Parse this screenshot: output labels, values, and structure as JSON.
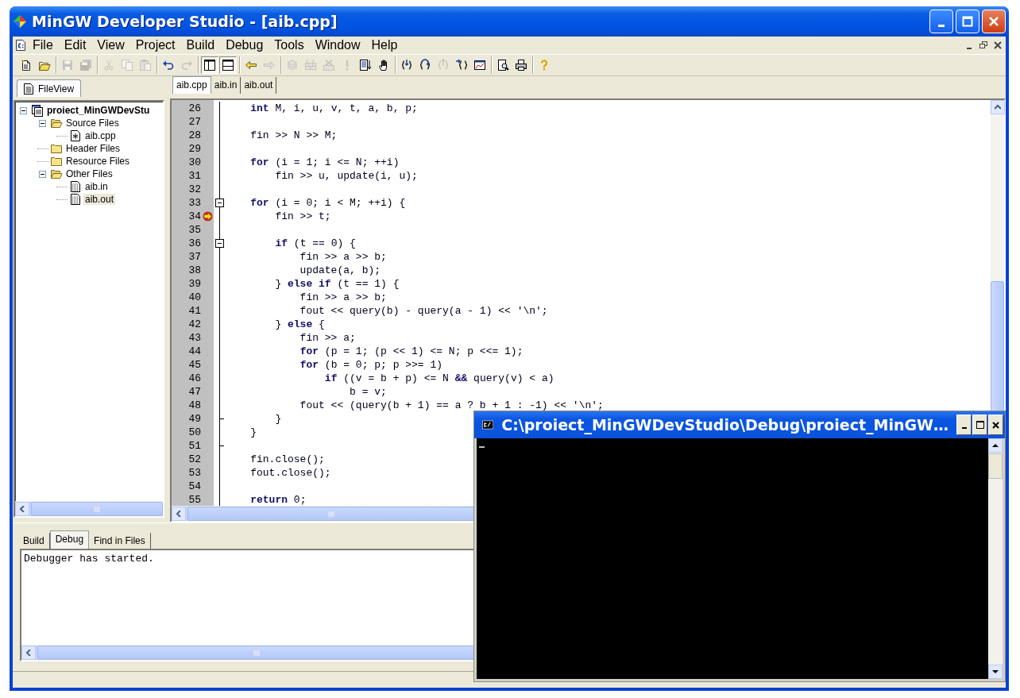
{
  "window": {
    "title": "MinGW Developer Studio - [aib.cpp]"
  },
  "menu": [
    {
      "label": "File"
    },
    {
      "label": "Edit"
    },
    {
      "label": "View"
    },
    {
      "label": "Project"
    },
    {
      "label": "Build"
    },
    {
      "label": "Debug"
    },
    {
      "label": "Tools"
    },
    {
      "label": "Window"
    },
    {
      "label": "Help"
    }
  ],
  "toolbar": [
    [
      {
        "kind": "new",
        "disabled": false,
        "pressed": false
      },
      {
        "kind": "open",
        "disabled": false,
        "pressed": false
      }
    ],
    [
      {
        "kind": "save",
        "disabled": true,
        "pressed": false
      },
      {
        "kind": "save_all",
        "disabled": true,
        "pressed": false
      }
    ],
    [
      {
        "kind": "cut",
        "disabled": true,
        "pressed": false
      },
      {
        "kind": "copy",
        "disabled": true,
        "pressed": false
      },
      {
        "kind": "paste",
        "disabled": true,
        "pressed": false
      }
    ],
    [
      {
        "kind": "undo",
        "disabled": false,
        "pressed": false
      },
      {
        "kind": "redo",
        "disabled": true,
        "pressed": false
      }
    ],
    [
      {
        "kind": "pane_left",
        "disabled": false,
        "pressed": true
      },
      {
        "kind": "pane_bottom",
        "disabled": false,
        "pressed": true
      }
    ],
    [
      {
        "kind": "back",
        "disabled": false,
        "pressed": false
      },
      {
        "kind": "forward",
        "disabled": true,
        "pressed": false
      }
    ],
    [
      {
        "kind": "compile",
        "disabled": true,
        "pressed": false
      },
      {
        "kind": "build",
        "disabled": true,
        "pressed": false
      },
      {
        "kind": "stop",
        "disabled": true,
        "pressed": false
      },
      {
        "kind": "execute",
        "disabled": true,
        "pressed": false
      },
      {
        "kind": "go",
        "disabled": false,
        "pressed": false
      },
      {
        "kind": "hand",
        "disabled": false,
        "pressed": false
      }
    ],
    [
      {
        "kind": "step_into",
        "disabled": false,
        "pressed": false
      },
      {
        "kind": "step_over",
        "disabled": false,
        "pressed": false
      },
      {
        "kind": "step_out",
        "disabled": true,
        "pressed": false
      },
      {
        "kind": "run_cursor",
        "disabled": false,
        "pressed": false
      },
      {
        "kind": "watch",
        "disabled": false,
        "pressed": false
      }
    ],
    [
      {
        "kind": "preview",
        "disabled": false,
        "pressed": false
      },
      {
        "kind": "print",
        "disabled": false,
        "pressed": false
      }
    ],
    [
      {
        "kind": "help",
        "disabled": false,
        "pressed": false
      }
    ]
  ],
  "sidebar": {
    "tabs": [
      {
        "label": "FileView",
        "selected": true
      }
    ],
    "tree": [
      {
        "label": "proiect_MinGWDevStu",
        "kind": "project",
        "expanded": true,
        "selected": false,
        "children": [
          {
            "label": "Source Files",
            "kind": "folder",
            "expanded": true,
            "selected": false,
            "children": [
              {
                "label": "aib.cpp",
                "kind": "source",
                "selected": false
              }
            ]
          },
          {
            "label": "Header Files",
            "kind": "folder",
            "expanded": false,
            "selected": false
          },
          {
            "label": "Resource Files",
            "kind": "folder",
            "expanded": false,
            "selected": false
          },
          {
            "label": "Other Files",
            "kind": "folder",
            "expanded": true,
            "selected": false,
            "children": [
              {
                "label": "aib.in",
                "kind": "file",
                "selected": false
              },
              {
                "label": "aib.out",
                "kind": "file",
                "selected": true
              }
            ]
          }
        ]
      }
    ]
  },
  "editor": {
    "tabs": [
      {
        "label": "aib.cpp",
        "selected": true
      },
      {
        "label": "aib.in",
        "selected": false
      },
      {
        "label": "aib.out",
        "selected": false
      }
    ],
    "lines": [
      {
        "num": "26",
        "code": "    **int** M, i, u, v, t, a, b, p;",
        "current": false
      },
      {
        "num": "27",
        "current": false
      },
      {
        "num": "28",
        "code": "    fin >> N >> M;",
        "current": false
      },
      {
        "num": "29",
        "current": false
      },
      {
        "num": "30",
        "code": "    **for** (i = 1; i <= N; ++i)",
        "current": false
      },
      {
        "num": "31",
        "code": "        fin >> u, update(i, u);",
        "current": false
      },
      {
        "num": "32",
        "current": false
      },
      {
        "num": "33",
        "code": "    **for** (i = 0; i < M; ++i) {",
        "kind": "fold_start",
        "current": false
      },
      {
        "num": "34",
        "code": "        fin >> t;",
        "current": true
      },
      {
        "num": "35",
        "current": false
      },
      {
        "num": "36",
        "code": "        **if** (t == 0) {",
        "kind": "fold_start",
        "current": false
      },
      {
        "num": "37",
        "code": "            fin >> a >> b;",
        "current": false
      },
      {
        "num": "38",
        "code": "            update(a, b);",
        "current": false
      },
      {
        "num": "39",
        "code": "        } **else if** (t == 1) {",
        "current": false
      },
      {
        "num": "40",
        "code": "            fin >> a >> b;",
        "current": false
      },
      {
        "num": "41",
        "code": "            fout << query(b) - query(a - 1) << '\\n';",
        "current": false
      },
      {
        "num": "42",
        "code": "        } **else** {",
        "current": false
      },
      {
        "num": "43",
        "code": "            fin >> a;",
        "current": false
      },
      {
        "num": "44",
        "code": "            **for** (p = 1; (p << 1) <= N; p <<= 1);",
        "current": false
      },
      {
        "num": "45",
        "code": "            **for** (b = 0; p; p >>= 1)",
        "current": false
      },
      {
        "num": "46",
        "code": "                **if** ((v = b + p) <= N **&&** query(v) < a)",
        "current": false
      },
      {
        "num": "47",
        "code": "                    b = v;",
        "current": false
      },
      {
        "num": "48",
        "code": "            fout << (query(b + 1) == a ? b + 1 : -1) << '\\n';",
        "current": false
      },
      {
        "num": "49",
        "code": "        }",
        "kind": "fold_end",
        "current": false
      },
      {
        "num": "50",
        "code": "    }",
        "current": false
      },
      {
        "num": "51",
        "kind": "fold_end",
        "current": false
      },
      {
        "num": "52",
        "code": "    fin.close();",
        "current": false
      },
      {
        "num": "53",
        "code": "    fout.close();",
        "current": false
      },
      {
        "num": "54",
        "current": false
      },
      {
        "num": "55",
        "code": "    **return** 0;",
        "current": false
      }
    ]
  },
  "output": {
    "tabs": [
      {
        "label": "Build",
        "selected": false
      },
      {
        "label": "Debug",
        "selected": true
      },
      {
        "label": "Find in Files",
        "selected": false
      }
    ],
    "text": "Debugger has started."
  },
  "console": {
    "title": "C:\\proiect_MinGWDevStudio\\Debug\\proiect_MinGW…"
  }
}
